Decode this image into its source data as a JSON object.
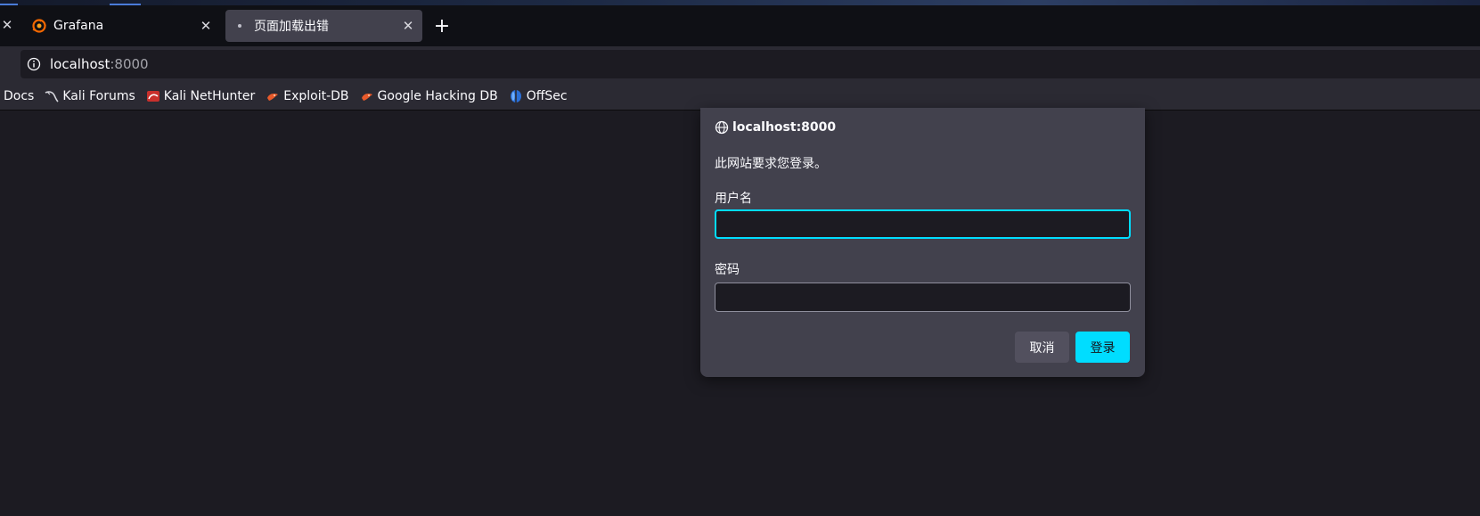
{
  "tabs": [
    {
      "title": "Grafana",
      "icon": "grafana-icon"
    },
    {
      "title": "页面加载出错",
      "icon": "loading-dot-icon",
      "active": true
    }
  ],
  "urlbar": {
    "host": "localhost",
    "port": ":8000"
  },
  "bookmarks": [
    {
      "label": "Docs",
      "icon": ""
    },
    {
      "label": "Kali Forums",
      "icon": "kali-dragon-icon"
    },
    {
      "label": "Kali NetHunter",
      "icon": "nethunter-icon"
    },
    {
      "label": "Exploit-DB",
      "icon": "exploitdb-icon"
    },
    {
      "label": "Google Hacking DB",
      "icon": "ghdb-icon"
    },
    {
      "label": "OffSec",
      "icon": "offsec-icon"
    }
  ],
  "dialog": {
    "origin": "localhost:8000",
    "message": "此网站要求您登录。",
    "username_label": "用户名",
    "username_value": "",
    "password_label": "密码",
    "password_value": "",
    "cancel_label": "取消",
    "login_label": "登录"
  },
  "colors": {
    "accent": "#00ddff",
    "dialog_bg": "#42414d",
    "toolbar_bg": "#2b2a33",
    "page_bg": "#1c1b22",
    "tabbar_bg": "#0f1015"
  }
}
